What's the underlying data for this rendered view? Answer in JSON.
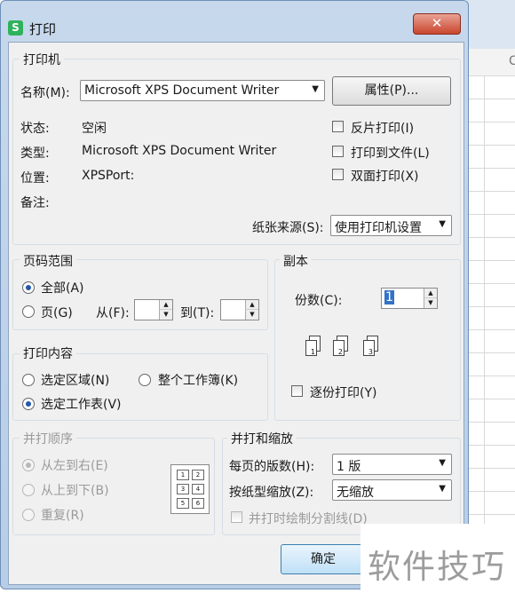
{
  "window": {
    "title": "打印",
    "close_label": "✕",
    "app_icon": "S"
  },
  "background": {
    "column_letter": "C"
  },
  "printer": {
    "legend": "打印机",
    "name_label": "名称(M):",
    "name_value": "Microsoft XPS Document Writer",
    "properties_button": "属性(P)...",
    "status_label": "状态:",
    "status_value": "空闲",
    "type_label": "类型:",
    "type_value": "Microsoft XPS Document Writer",
    "location_label": "位置:",
    "location_value": "XPSPort:",
    "comment_label": "备注:",
    "reverse_print": "反片打印(I)",
    "print_to_file": "打印到文件(L)",
    "duplex_print": "双面打印(X)",
    "paper_source_label": "纸张来源(S):",
    "paper_source_value": "使用打印机设置"
  },
  "page_range": {
    "legend": "页码范围",
    "all_label": "全部(A)",
    "pages_label": "页(G)",
    "from_label": "从(F):",
    "to_label": "到(T):",
    "from_value": "",
    "to_value": "",
    "selected": "all"
  },
  "copies": {
    "legend": "副本",
    "count_label": "份数(C):",
    "count_value": "1",
    "collate_label": "逐份打印(Y)",
    "collate_pages": [
      "1",
      "2",
      "3"
    ]
  },
  "print_what": {
    "legend": "打印内容",
    "selection_label": "选定区域(N)",
    "entire_workbook_label": "整个工作簿(K)",
    "active_sheet_label": "选定工作表(V)",
    "selected": "active_sheet"
  },
  "collate_order": {
    "legend": "并打顺序",
    "left_to_right": "从左到右(E)",
    "top_to_bottom": "从上到下(B)",
    "repeat": "重复(R)",
    "grid_numbers": [
      "1",
      "2",
      "3",
      "4",
      "5",
      "6"
    ]
  },
  "zoom": {
    "legend": "并打和缩放",
    "pages_per_sheet_label": "每页的版数(H):",
    "pages_per_sheet_value": "1 版",
    "scale_label": "按纸型缩放(Z):",
    "scale_value": "无缩放",
    "draw_borders_label": "并打时绘制分割线(D)"
  },
  "buttons": {
    "ok": "确定"
  },
  "watermark": {
    "text": "软件技巧"
  }
}
